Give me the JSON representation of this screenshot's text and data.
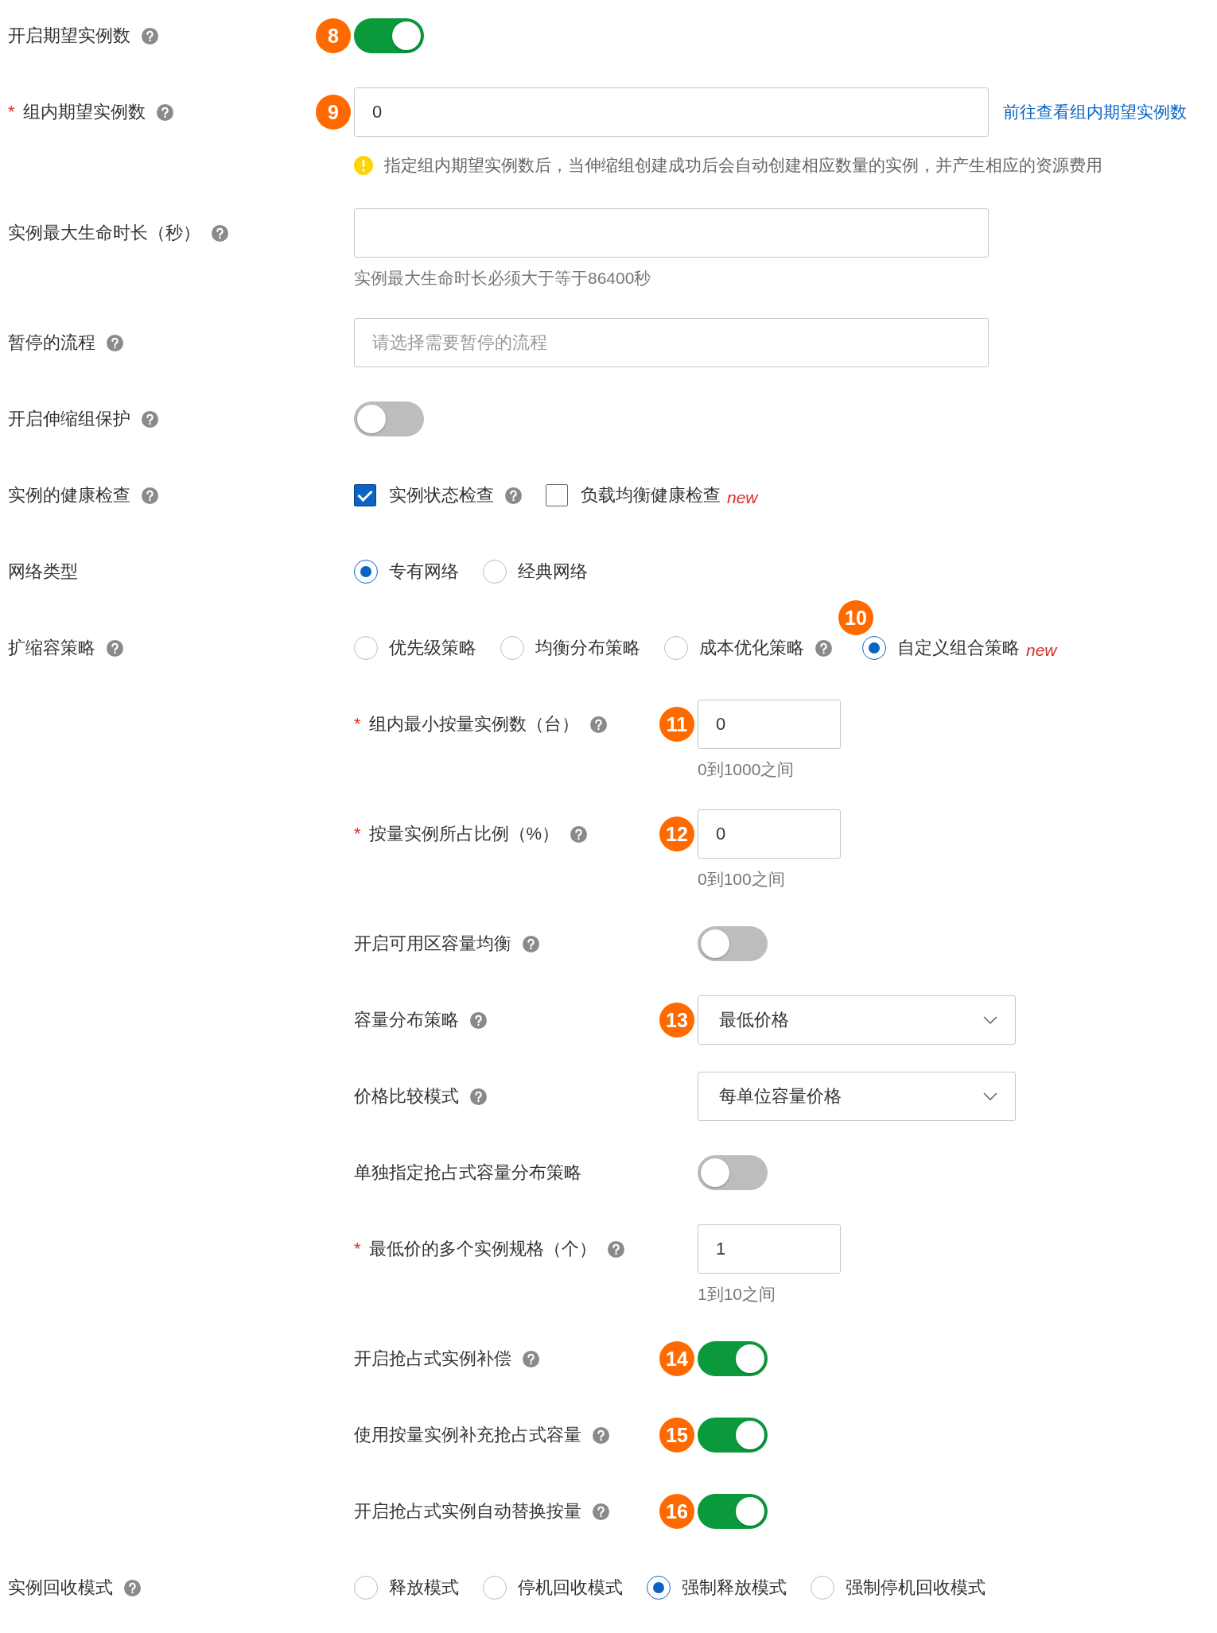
{
  "fields": [
    {
      "kind": "switch",
      "label": "开启期望实例数",
      "help": true,
      "badge": "8",
      "on": true
    },
    {
      "kind": "input",
      "label": "组内期望实例数",
      "required_mark": "*",
      "help": true,
      "badge": "9",
      "value": "0",
      "link": "前往查看组内期望实例数",
      "warning": "指定组内期望实例数后，当伸缩组创建成功后会自动创建相应数量的实例，并产生相应的资源费用"
    },
    {
      "kind": "input",
      "label": "实例最大生命时长（秒）",
      "help": true,
      "hint": "实例最大生命时长必须大于等于86400秒"
    },
    {
      "kind": "input",
      "label": "暂停的流程",
      "help": true,
      "placeholder": "请选择需要暂停的流程"
    },
    {
      "kind": "switch",
      "label": "开启伸缩组保护",
      "help": true,
      "on": false
    },
    {
      "kind": "checks",
      "label": "实例的健康检查",
      "help": true,
      "options": [
        {
          "label": "实例状态检查",
          "checked": true,
          "help": true
        },
        {
          "label": "负载均衡健康检查",
          "checked": false,
          "tag": "new"
        }
      ]
    },
    {
      "kind": "radios",
      "label": "网络类型",
      "options": [
        {
          "label": "专有网络",
          "selected": true
        },
        {
          "label": "经典网络",
          "selected": false
        }
      ]
    },
    {
      "kind": "radios",
      "label": "扩缩容策略",
      "help": true,
      "options": [
        {
          "label": "优先级策略",
          "selected": false
        },
        {
          "label": "均衡分布策略",
          "selected": false
        },
        {
          "label": "成本优化策略",
          "selected": false,
          "help": true
        },
        {
          "label": "自定义组合策略",
          "selected": true,
          "tag": "new",
          "badge": "10"
        }
      ],
      "children": [
        {
          "kind": "input",
          "label": "组内最小按量实例数（台）",
          "required_mark": "*",
          "help": true,
          "badge": "11",
          "value": "0",
          "hint": "0到1000之间"
        },
        {
          "kind": "input",
          "label": "按量实例所占比例（%）",
          "required_mark": "*",
          "help": true,
          "badge": "12",
          "value": "0",
          "hint": "0到100之间"
        },
        {
          "kind": "switch",
          "label": "开启可用区容量均衡",
          "help": true,
          "on": false
        },
        {
          "kind": "select",
          "label": "容量分布策略",
          "help": true,
          "badge": "13",
          "value": "最低价格"
        },
        {
          "kind": "select",
          "label": "价格比较模式",
          "help": true,
          "value": "每单位容量价格"
        },
        {
          "kind": "switch",
          "label": "单独指定抢占式容量分布策略",
          "on": false
        },
        {
          "kind": "input",
          "label": "最低价的多个实例规格（个）",
          "required_mark": "*",
          "help": true,
          "value": "1",
          "hint": "1到10之间"
        },
        {
          "kind": "switch",
          "label": "开启抢占式实例补偿",
          "help": true,
          "badge": "14",
          "on": true
        },
        {
          "kind": "switch",
          "label": "使用按量实例补充抢占式容量",
          "help": true,
          "badge": "15",
          "on": true
        },
        {
          "kind": "switch",
          "label": "开启抢占式实例自动替换按量",
          "help": true,
          "badge": "16",
          "on": true
        }
      ]
    },
    {
      "kind": "radios",
      "label": "实例回收模式",
      "help": true,
      "options": [
        {
          "label": "释放模式",
          "selected": false
        },
        {
          "label": "停机回收模式",
          "selected": false
        },
        {
          "label": "强制释放模式",
          "selected": true
        },
        {
          "label": "强制停机回收模式",
          "selected": false
        }
      ]
    }
  ]
}
